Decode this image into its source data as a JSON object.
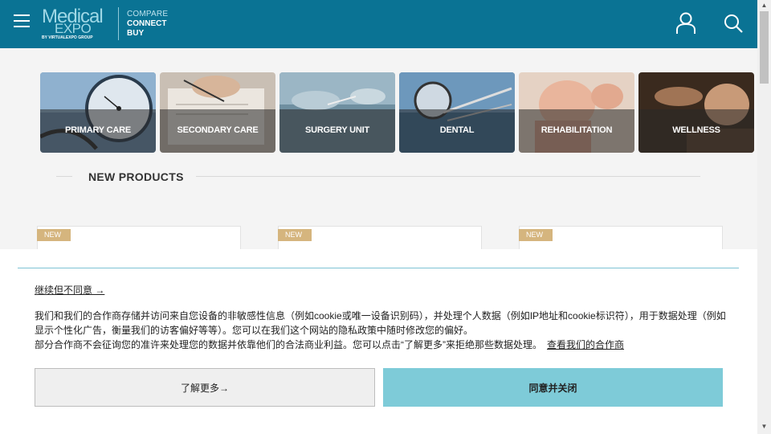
{
  "header": {
    "logo_main": "Medical",
    "logo_sub": "EXPO",
    "logo_group": "BY VIRTUALEXPO GROUP",
    "tagline": [
      "COMPARE",
      "CONNECT",
      "BUY"
    ],
    "menu_icon": "hamburger-menu-icon",
    "account_icon": "user-icon",
    "search_icon": "search-icon",
    "background_color": "#0a7394"
  },
  "categories": [
    {
      "label": "PRIMARY CARE"
    },
    {
      "label": "SECONDARY CARE"
    },
    {
      "label": "SURGERY UNIT"
    },
    {
      "label": "DENTAL"
    },
    {
      "label": "REHABILITATION"
    },
    {
      "label": "WELLNESS"
    }
  ],
  "section": {
    "title": "NEW PRODUCTS"
  },
  "products": [
    {
      "badge": "NEW"
    },
    {
      "badge": "NEW"
    },
    {
      "badge": "NEW"
    }
  ],
  "consent": {
    "reject_link": "继续但不同意 →",
    "text_line1": "我们和我们的合作商存储并访问来自您设备的非敏感性信息（例如cookie或唯一设备识别码），并处理个人数据（例如IP地址和cookie标识符），用于数据处理（例如显示个性化广告，衡量我们的访客偏好等等）。您可以在我们这个网站的隐私政策中随时修改您的偏好。",
    "text_line2": "部分合作商不会征询您的准许来处理您的数据并依靠他们的合法商业利益。您可以点击“了解更多”来拒绝那些数据处理。",
    "partners_link": "查看我们的合作商",
    "learn_more_button": "了解更多→",
    "accept_button": "同意并关闭",
    "accent_color": "#7ecbd8"
  }
}
